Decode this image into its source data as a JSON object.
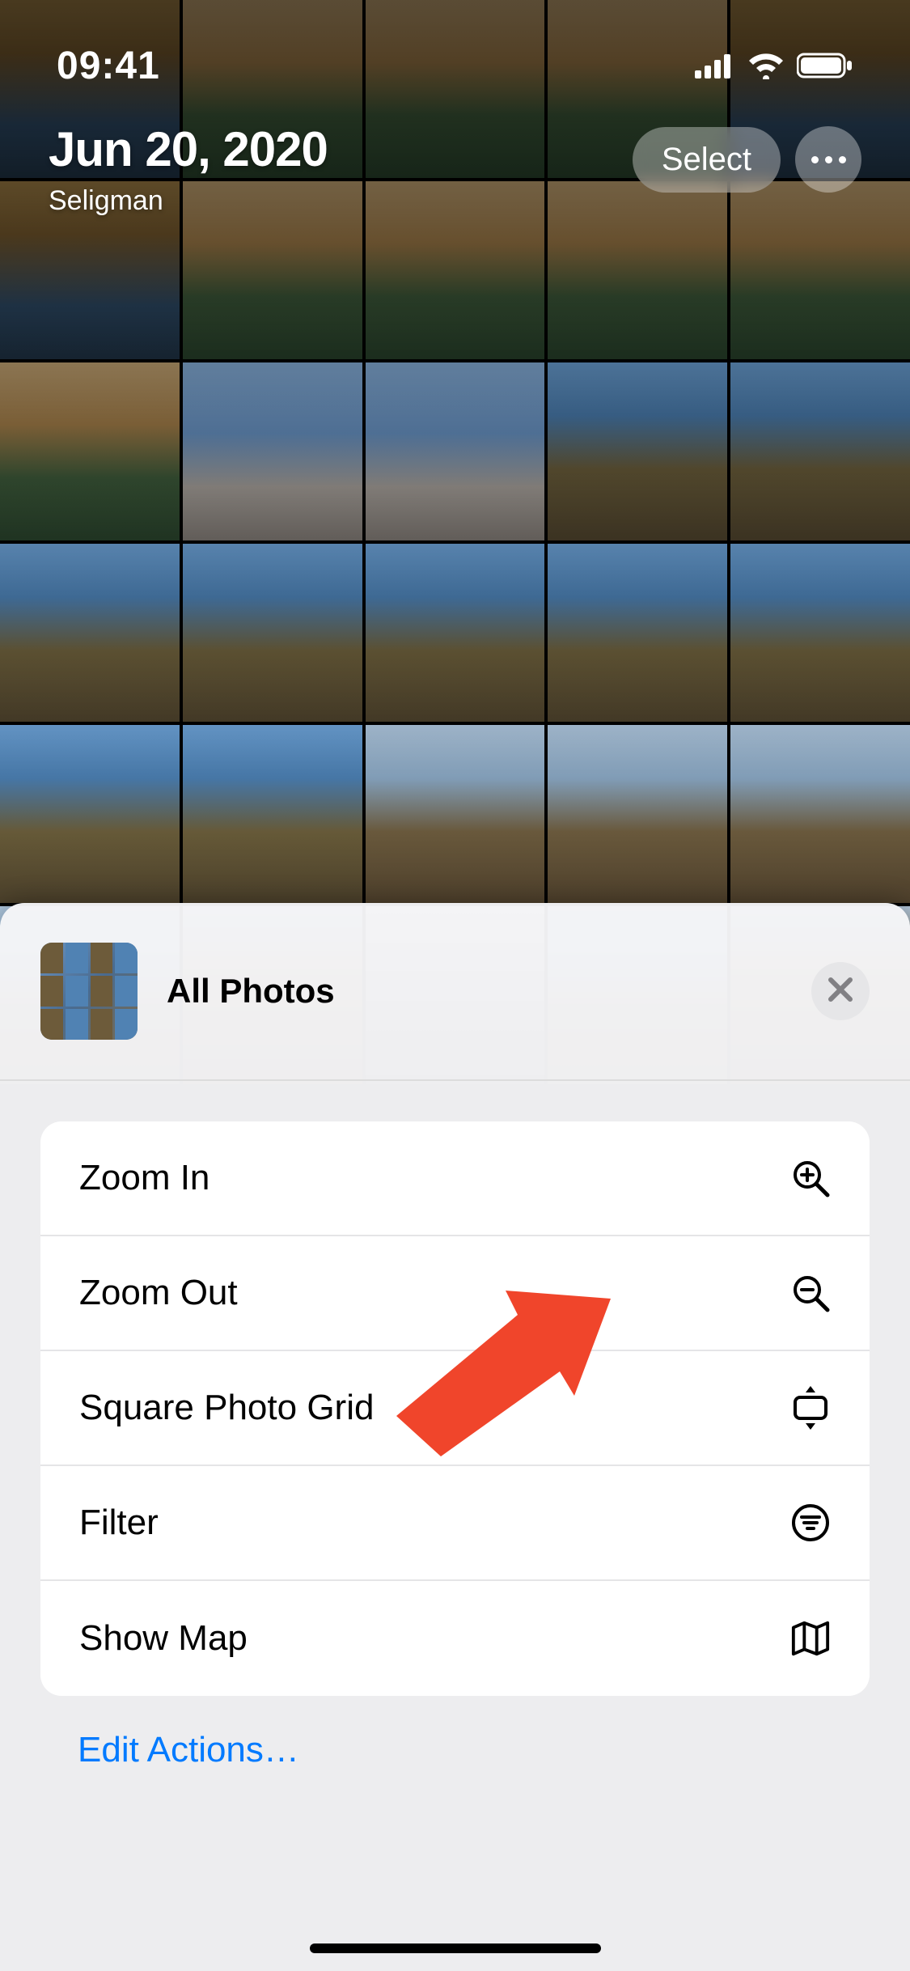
{
  "status_bar": {
    "time": "09:41"
  },
  "header": {
    "date": "Jun 20, 2020",
    "location": "Seligman",
    "select_label": "Select"
  },
  "sheet": {
    "title": "All Photos",
    "actions": [
      {
        "label": "Zoom In",
        "icon": "zoom-in-icon"
      },
      {
        "label": "Zoom Out",
        "icon": "zoom-out-icon"
      },
      {
        "label": "Square Photo Grid",
        "icon": "square-grid-icon"
      },
      {
        "label": "Filter",
        "icon": "filter-icon"
      },
      {
        "label": "Show Map",
        "icon": "map-icon"
      }
    ],
    "edit_actions_label": "Edit Actions…"
  },
  "annotation": {
    "arrow_color": "#f0452b"
  }
}
